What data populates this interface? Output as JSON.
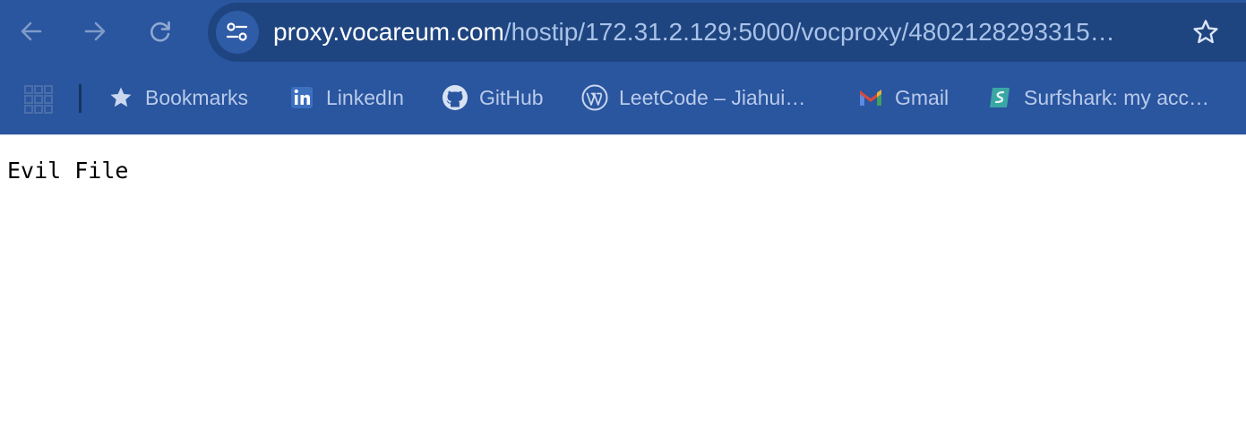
{
  "browser": {
    "nav": {
      "back_icon": "arrow-left-icon",
      "forward_icon": "arrow-right-icon",
      "reload_icon": "reload-icon"
    },
    "address_bar": {
      "site_info_icon": "tune-icon",
      "url_host": "proxy.vocareum.com",
      "url_path": "/hostip/172.31.2.129:5000/vocproxy/4802128293315…",
      "bookmark_icon": "star-outline-icon"
    },
    "bookmarks": [
      {
        "label": "Bookmarks",
        "icon": "star-icon"
      },
      {
        "label": "LinkedIn",
        "icon": "linkedin-icon"
      },
      {
        "label": "GitHub",
        "icon": "github-icon"
      },
      {
        "label": "LeetCode – Jiahui…",
        "icon": "wordpress-icon"
      },
      {
        "label": "Gmail",
        "icon": "gmail-icon"
      },
      {
        "label": "Surfshark: my acc…",
        "icon": "surfshark-icon"
      }
    ],
    "colors": {
      "toolbar": "#2A559F",
      "omnibox": "#1F4580",
      "url_host": "#FFFFFF",
      "url_path": "#A9C2E8"
    }
  },
  "page": {
    "body_text": "Evil File"
  }
}
